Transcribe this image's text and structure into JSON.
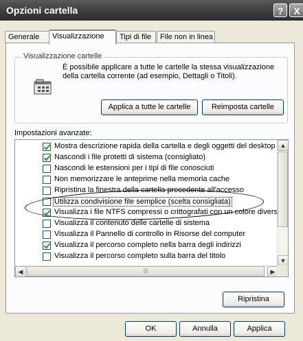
{
  "window": {
    "title": "Opzioni cartella",
    "help_glyph": "?",
    "close_glyph": "X"
  },
  "tabs": [
    "Generale",
    "Visualizzazione",
    "Tipi di file",
    "File non in linea"
  ],
  "folder_views": {
    "legend": "Visualizzazione cartelle",
    "description": "È possibile applicare a tutte le cartelle la stessa visualizzazione della cartella corrente (ad esempio, Dettagli o Titoli).",
    "apply_all_label": "Applica a tutte le cartelle",
    "reset_label": "Reimposta cartelle"
  },
  "advanced": {
    "label": "Impostazioni avanzate:",
    "items": [
      {
        "text": "Mostra descrizione rapida della cartella e degli oggetti del desktop",
        "checked": true
      },
      {
        "text": "Nascondi i file protetti di sistema (consigliato)",
        "checked": true
      },
      {
        "text": "Nascondi le estensioni per i tipi di file conosciuti",
        "checked": false
      },
      {
        "text": "Non memorizzare le anteprime nella memoria cache",
        "checked": false
      },
      {
        "text": "Ripristina la finestra della cartella precedente all'accesso",
        "checked": false
      },
      {
        "text": "Utilizza condivisione file semplice (scelta consigliata)",
        "checked": false,
        "selected": true
      },
      {
        "text": "Visualizza i file NTFS compressi o crittografati con un colore diverso",
        "checked": true
      },
      {
        "text": "Visualizza il contenuto delle cartelle di sistema",
        "checked": false
      },
      {
        "text": "Visualizza il Pannello di controllo in Risorse del computer",
        "checked": false
      },
      {
        "text": "Visualizza il percorso completo nella barra degli indirizzi",
        "checked": true
      },
      {
        "text": "Visualizza il percorso completo sulla barra del titolo",
        "checked": false
      }
    ],
    "restore_label": "Ripristina"
  },
  "footer": {
    "ok_label": "OK",
    "cancel_label": "Annulla",
    "apply_label": "Applica"
  }
}
